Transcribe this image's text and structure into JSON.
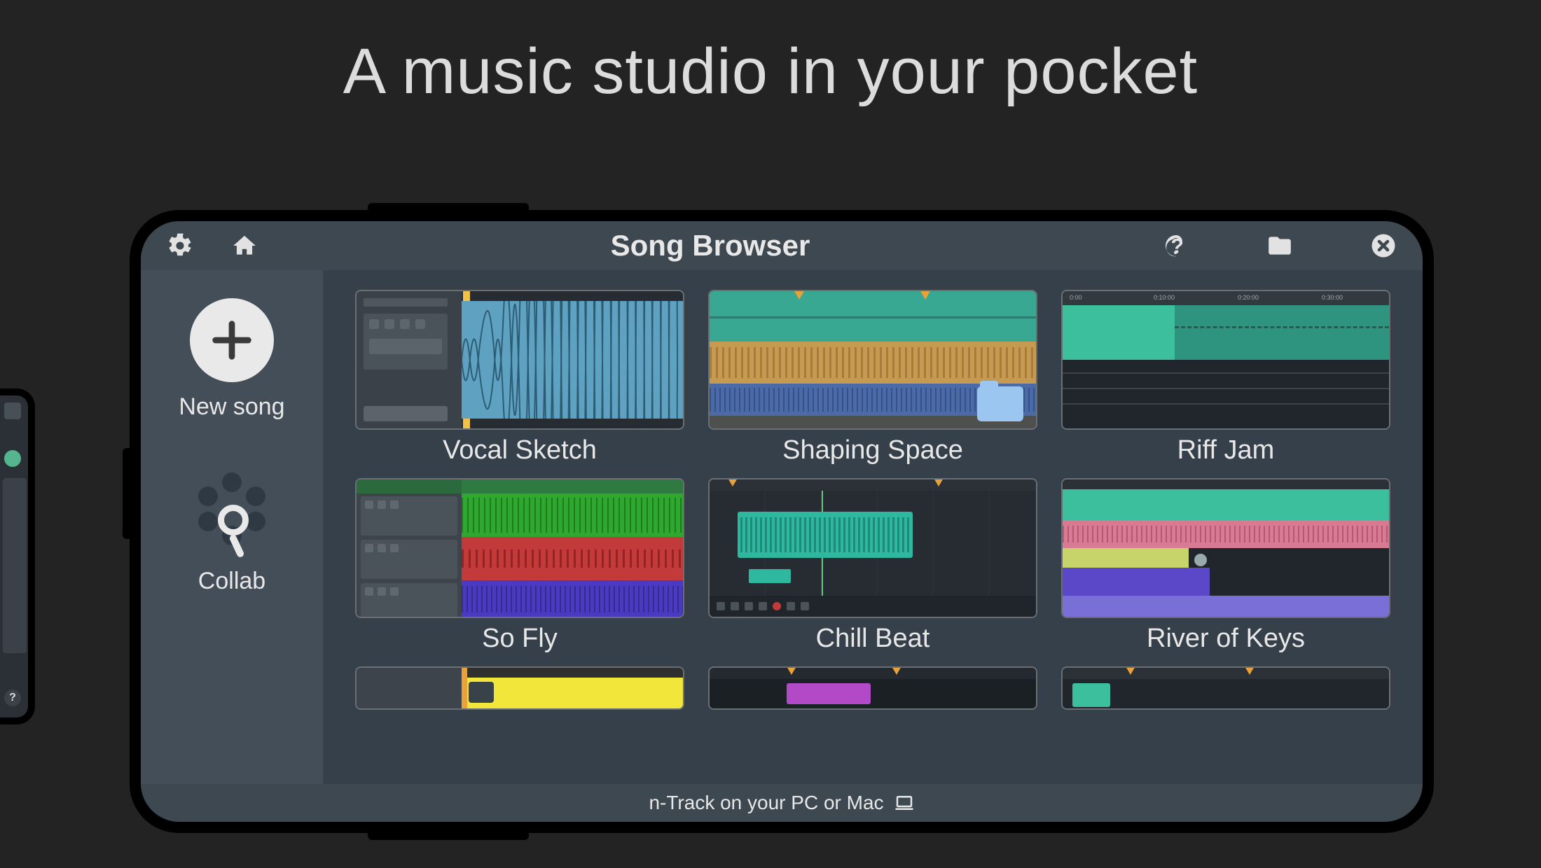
{
  "headline": "A music studio in your pocket",
  "topbar": {
    "title": "Song Browser"
  },
  "sidebar": {
    "new_song_label": "New song",
    "collab_label": "Collab"
  },
  "songs": {
    "r1c1": "Vocal Sketch",
    "r1c2": "Shaping Space",
    "r1c3": "Riff Jam",
    "r2c1": "So Fly",
    "r2c2": "Chill Beat",
    "r2c3": "River of Keys"
  },
  "footer": {
    "text": "n-Track on your PC or Mac"
  }
}
